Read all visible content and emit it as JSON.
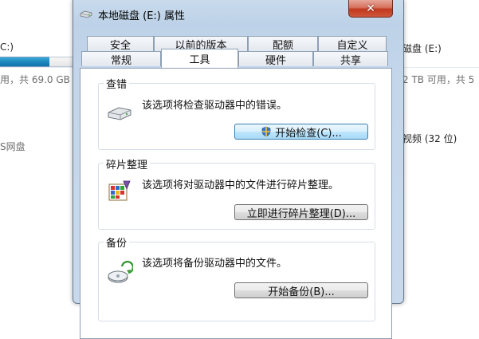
{
  "background": {
    "left_drive_label": "C:)",
    "left_free_text": "用，共 69.0 GB",
    "left_network_text": "S网盘",
    "right_drive_label": "磁盘 (E:)",
    "right_free_text": "2 TB 可用，共 5",
    "right_video_text": "视频 (32 位)"
  },
  "dialog": {
    "title": "本地磁盘 (E:) 属性",
    "close_symbol": "✕",
    "tabs_top": [
      "安全",
      "以前的版本",
      "配额",
      "自定义"
    ],
    "tabs_bottom": [
      "常规",
      "工具",
      "硬件",
      "共享"
    ],
    "active_tab": "工具",
    "groups": [
      {
        "title": "查错",
        "description": "该选项将检查驱动器中的错误。",
        "button": "开始检查(C)...",
        "icon": "disk-check-icon"
      },
      {
        "title": "碎片整理",
        "description": "该选项将对驱动器中的文件进行碎片整理。",
        "button": "立即进行碎片整理(D)...",
        "icon": "defrag-icon"
      },
      {
        "title": "备份",
        "description": "该选项将备份驱动器中的文件。",
        "button": "开始备份(B)...",
        "icon": "backup-icon"
      }
    ]
  },
  "colors": {
    "progress_fill": "#1b84bb",
    "close_button": "#c1391d",
    "dialog_frame": "#bdd2e8"
  }
}
